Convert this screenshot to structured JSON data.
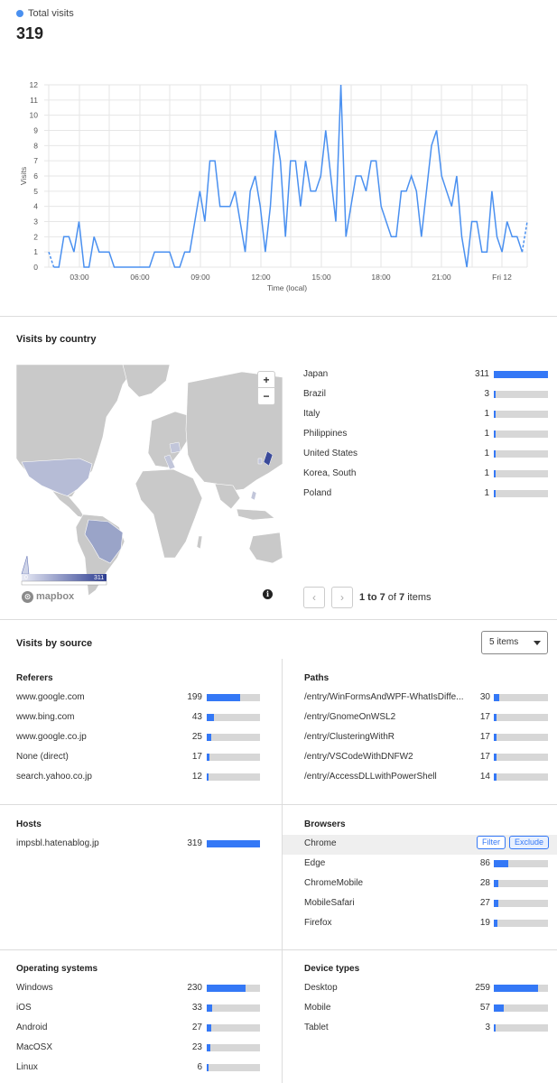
{
  "header": {
    "label": "Total visits",
    "value": "319",
    "accent": "#4a90f0"
  },
  "chart_data": {
    "type": "line",
    "ylabel": "Visits",
    "xlabel": "Time (local)",
    "ylim": [
      0,
      12
    ],
    "yticks": [
      "0",
      "1",
      "2",
      "3",
      "4",
      "5",
      "6",
      "7",
      "8",
      "9",
      "10",
      "11",
      "12"
    ],
    "xtick_labels": [
      "03:00",
      "06:00",
      "09:00",
      "12:00",
      "15:00",
      "18:00",
      "21:00",
      "Fri 12"
    ],
    "grid": true,
    "series": [
      {
        "values": [
          1,
          0,
          0,
          2,
          2,
          1,
          3,
          0,
          0,
          2,
          1,
          1,
          1,
          0,
          0,
          0,
          0,
          0,
          0,
          0,
          0,
          1,
          1,
          1,
          1,
          0,
          0,
          1,
          1,
          3,
          5,
          3,
          7,
          7,
          4,
          4,
          4,
          5,
          3,
          1,
          5,
          6,
          4,
          1,
          4,
          9,
          7,
          2,
          7,
          7,
          4,
          7,
          5,
          5,
          6,
          9,
          6,
          3,
          12,
          2,
          4,
          6,
          6,
          5,
          7,
          7,
          4,
          3,
          2,
          2,
          5,
          5,
          6,
          5,
          2,
          5,
          8,
          9,
          6,
          5,
          4,
          6,
          2,
          0,
          3,
          3,
          1,
          1,
          5,
          2,
          1,
          3,
          2,
          2,
          1,
          3
        ],
        "dashed_start": 1,
        "dashed_end": 1
      }
    ]
  },
  "country": {
    "title": "Visits by country",
    "items": [
      {
        "label": "Japan",
        "value": 311
      },
      {
        "label": "Brazil",
        "value": 3
      },
      {
        "label": "Italy",
        "value": 1
      },
      {
        "label": "Philippines",
        "value": 1
      },
      {
        "label": "United States",
        "value": 1
      },
      {
        "label": "Korea, South",
        "value": 1
      },
      {
        "label": "Poland",
        "value": 1
      }
    ],
    "max": 311,
    "zoom_in": "+",
    "zoom_out": "−",
    "legend_min": "0",
    "legend_max": "311",
    "mapbox_label": "mapbox",
    "info_icon": "i",
    "pager_prev": "‹",
    "pager_next": "›",
    "pager_text_range": "1 to 7",
    "pager_text_of": " of ",
    "pager_text_total": "7",
    "pager_text_items": " items"
  },
  "source": {
    "title": "Visits by source",
    "select_value": "5 items",
    "referers": {
      "title": "Referers",
      "max": 319,
      "items": [
        {
          "label": "www.google.com",
          "value": 199
        },
        {
          "label": "www.bing.com",
          "value": 43
        },
        {
          "label": "www.google.co.jp",
          "value": 25
        },
        {
          "label": "None (direct)",
          "value": 17
        },
        {
          "label": "search.yahoo.co.jp",
          "value": 12
        }
      ]
    },
    "paths": {
      "title": "Paths",
      "max": 319,
      "items": [
        {
          "label": "/entry/WinFormsAndWPF-WhatIsDiffe...",
          "value": 30
        },
        {
          "label": "/entry/GnomeOnWSL2",
          "value": 17
        },
        {
          "label": "/entry/ClusteringWithR",
          "value": 17
        },
        {
          "label": "/entry/VSCodeWithDNFW2",
          "value": 17
        },
        {
          "label": "/entry/AccessDLLwithPowerShell",
          "value": 14
        }
      ]
    },
    "hosts": {
      "title": "Hosts",
      "max": 319,
      "items": [
        {
          "label": "impsbl.hatenablog.jp",
          "value": 319
        }
      ]
    },
    "browsers": {
      "title": "Browsers",
      "max": 319,
      "filter_label": "Filter",
      "exclude_label": "Exclude",
      "items": [
        {
          "label": "Chrome",
          "value": ""
        },
        {
          "label": "Edge",
          "value": 86
        },
        {
          "label": "ChromeMobile",
          "value": 28
        },
        {
          "label": "MobileSafari",
          "value": 27
        },
        {
          "label": "Firefox",
          "value": 19
        }
      ]
    },
    "os": {
      "title": "Operating systems",
      "max": 319,
      "items": [
        {
          "label": "Windows",
          "value": 230
        },
        {
          "label": "iOS",
          "value": 33
        },
        {
          "label": "Android",
          "value": 27
        },
        {
          "label": "MacOSX",
          "value": 23
        },
        {
          "label": "Linux",
          "value": 6
        }
      ]
    },
    "devices": {
      "title": "Device types",
      "max": 319,
      "items": [
        {
          "label": "Desktop",
          "value": 259
        },
        {
          "label": "Mobile",
          "value": 57
        },
        {
          "label": "Tablet",
          "value": 3
        }
      ]
    }
  }
}
